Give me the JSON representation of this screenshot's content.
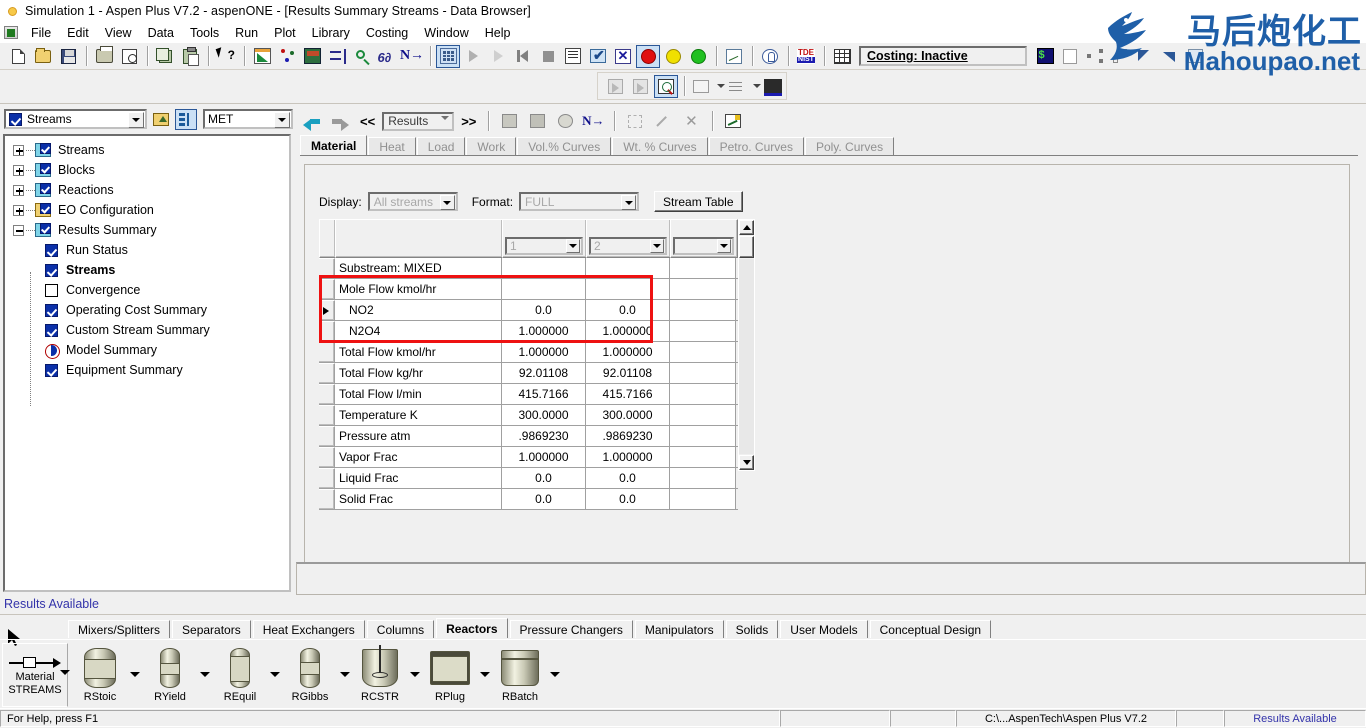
{
  "window": {
    "title": "Simulation 1 - Aspen Plus V7.2 - aspenONE - [Results Summary Streams - Data Browser]",
    "app_icon": "aspen-sun-icon"
  },
  "menubar": {
    "items": [
      "File",
      "Edit",
      "View",
      "Data",
      "Tools",
      "Run",
      "Plot",
      "Library",
      "Costing",
      "Window",
      "Help"
    ]
  },
  "toolbar": {
    "costing_status": "Costing: Inactive",
    "buttons": [
      "new-document",
      "open-folder",
      "save",
      "print",
      "print-preview",
      "copy",
      "paste",
      "help-pointer",
      "setup",
      "components",
      "properties",
      "streams",
      "blocks",
      "next",
      "data-browser",
      "run",
      "step",
      "restart",
      "stop",
      "control-panel",
      "check-results",
      "reconcile",
      "status-red",
      "status-yellow",
      "status-green",
      "history",
      "model-analysis",
      "tde",
      "grid-table"
    ]
  },
  "navtoolbar": {
    "back": "back-arrow",
    "forward": "forward-arrow",
    "prev": "<<",
    "view_value": "Results",
    "next": ">>"
  },
  "navpanel": {
    "selector_value": "Streams",
    "units_value": "MET",
    "tree": [
      {
        "label": "Streams",
        "expander": "plus",
        "folder": "cyan",
        "checked": true,
        "indent": 0,
        "bold": false
      },
      {
        "label": "Blocks",
        "expander": "plus",
        "folder": "cyan",
        "checked": true,
        "indent": 0,
        "bold": false
      },
      {
        "label": "Reactions",
        "expander": "plus",
        "folder": "cyan",
        "checked": true,
        "indent": 0,
        "bold": false
      },
      {
        "label": "EO Configuration",
        "expander": "plus",
        "folder": "yellow",
        "checked": true,
        "indent": 0,
        "bold": false
      },
      {
        "label": "Results Summary",
        "expander": "minus",
        "folder": "cyan",
        "checked": true,
        "indent": 0,
        "bold": false
      },
      {
        "label": "Run Status",
        "expander": "none",
        "folder": "none",
        "check": "blue",
        "indent": 1,
        "bold": false
      },
      {
        "label": "Streams",
        "expander": "none",
        "folder": "none",
        "check": "blue",
        "indent": 1,
        "bold": true
      },
      {
        "label": "Convergence",
        "expander": "none",
        "folder": "none",
        "check": "empty",
        "indent": 1,
        "bold": false
      },
      {
        "label": "Operating Cost Summary",
        "expander": "none",
        "folder": "none",
        "check": "blue",
        "indent": 1,
        "bold": false
      },
      {
        "label": "Custom Stream Summary",
        "expander": "none",
        "folder": "none",
        "check": "blue",
        "indent": 1,
        "bold": false
      },
      {
        "label": "Model Summary",
        "expander": "none",
        "folder": "none",
        "check": "half",
        "indent": 1,
        "bold": false
      },
      {
        "label": "Equipment Summary",
        "expander": "none",
        "folder": "none",
        "check": "blue",
        "indent": 1,
        "bold": false
      }
    ]
  },
  "sheet": {
    "tabs": [
      {
        "label": "Material",
        "active": true
      },
      {
        "label": "Heat",
        "active": false
      },
      {
        "label": "Load",
        "active": false
      },
      {
        "label": "Work",
        "active": false
      },
      {
        "label": "Vol.% Curves",
        "active": false
      },
      {
        "label": "Wt. % Curves",
        "active": false
      },
      {
        "label": "Petro. Curves",
        "active": false
      },
      {
        "label": "Poly. Curves",
        "active": false
      }
    ],
    "display_label": "Display:",
    "display_value": "All streams",
    "format_label": "Format:",
    "format_value": "FULL",
    "stream_table_button": "Stream Table"
  },
  "table": {
    "column_headers": [
      "",
      "1",
      "2",
      ""
    ],
    "rows": [
      {
        "label": "Substream: MIXED",
        "v1": "",
        "v2": "",
        "v3": "",
        "indent": false,
        "current": false,
        "highlight": false
      },
      {
        "label": "Mole Flow kmol/hr",
        "v1": "",
        "v2": "",
        "v3": "",
        "indent": false,
        "current": false,
        "highlight": true
      },
      {
        "label": "NO2",
        "v1": "0.0",
        "v2": "0.0",
        "v3": "",
        "indent": true,
        "current": true,
        "highlight": true
      },
      {
        "label": "N2O4",
        "v1": "1.000000",
        "v2": "1.000000",
        "v3": "",
        "indent": true,
        "current": false,
        "highlight": true
      },
      {
        "label": "Total Flow kmol/hr",
        "v1": "1.000000",
        "v2": "1.000000",
        "v3": "",
        "indent": false,
        "current": false,
        "highlight": false
      },
      {
        "label": "Total Flow kg/hr",
        "v1": "92.01108",
        "v2": "92.01108",
        "v3": "",
        "indent": false,
        "current": false,
        "highlight": false
      },
      {
        "label": "Total Flow l/min",
        "v1": "415.7166",
        "v2": "415.7166",
        "v3": "",
        "indent": false,
        "current": false,
        "highlight": false
      },
      {
        "label": "Temperature K",
        "v1": "300.0000",
        "v2": "300.0000",
        "v3": "",
        "indent": false,
        "current": false,
        "highlight": false
      },
      {
        "label": "Pressure atm",
        "v1": ".9869230",
        "v2": ".9869230",
        "v3": "",
        "indent": false,
        "current": false,
        "highlight": false
      },
      {
        "label": "Vapor Frac",
        "v1": "1.000000",
        "v2": "1.000000",
        "v3": "",
        "indent": false,
        "current": false,
        "highlight": false
      },
      {
        "label": "Liquid Frac",
        "v1": "0.0",
        "v2": "0.0",
        "v3": "",
        "indent": false,
        "current": false,
        "highlight": false
      },
      {
        "label": "Solid Frac",
        "v1": "0.0",
        "v2": "0.0",
        "v3": "",
        "indent": false,
        "current": false,
        "highlight": false
      }
    ],
    "highlight_color": "#ee1111"
  },
  "palette": {
    "results_label": "Results Available",
    "tabs": [
      {
        "label": "Mixers/Splitters",
        "active": false
      },
      {
        "label": "Separators",
        "active": false
      },
      {
        "label": "Heat Exchangers",
        "active": false
      },
      {
        "label": "Columns",
        "active": false
      },
      {
        "label": "Reactors",
        "active": true
      },
      {
        "label": "Pressure Changers",
        "active": false
      },
      {
        "label": "Manipulators",
        "active": false
      },
      {
        "label": "Solids",
        "active": false
      },
      {
        "label": "User Models",
        "active": false
      },
      {
        "label": "Conceptual Design",
        "active": false
      }
    ],
    "streams_label_top": "Material",
    "streams_label_bottom": "STREAMS",
    "models": [
      {
        "name": "RStoic",
        "shape": "rounded-xhatch"
      },
      {
        "name": "RYield",
        "shape": "narrow-x"
      },
      {
        "name": "REquil",
        "shape": "narrow-bars"
      },
      {
        "name": "RGibbs",
        "shape": "narrow-x2"
      },
      {
        "name": "RCSTR",
        "shape": "stirred-tank"
      },
      {
        "name": "RPlug",
        "shape": "tube-bundle"
      },
      {
        "name": "RBatch",
        "shape": "flat-tank"
      }
    ]
  },
  "statusbar": {
    "help_text": "For Help, press F1",
    "path": "C:\\...AspenTech\\Aspen Plus V7.2",
    "results": "Results Available"
  },
  "watermark": {
    "chinese": "马后炮化工",
    "english": "Mahoupao.net",
    "color": "#1f5fa8"
  }
}
